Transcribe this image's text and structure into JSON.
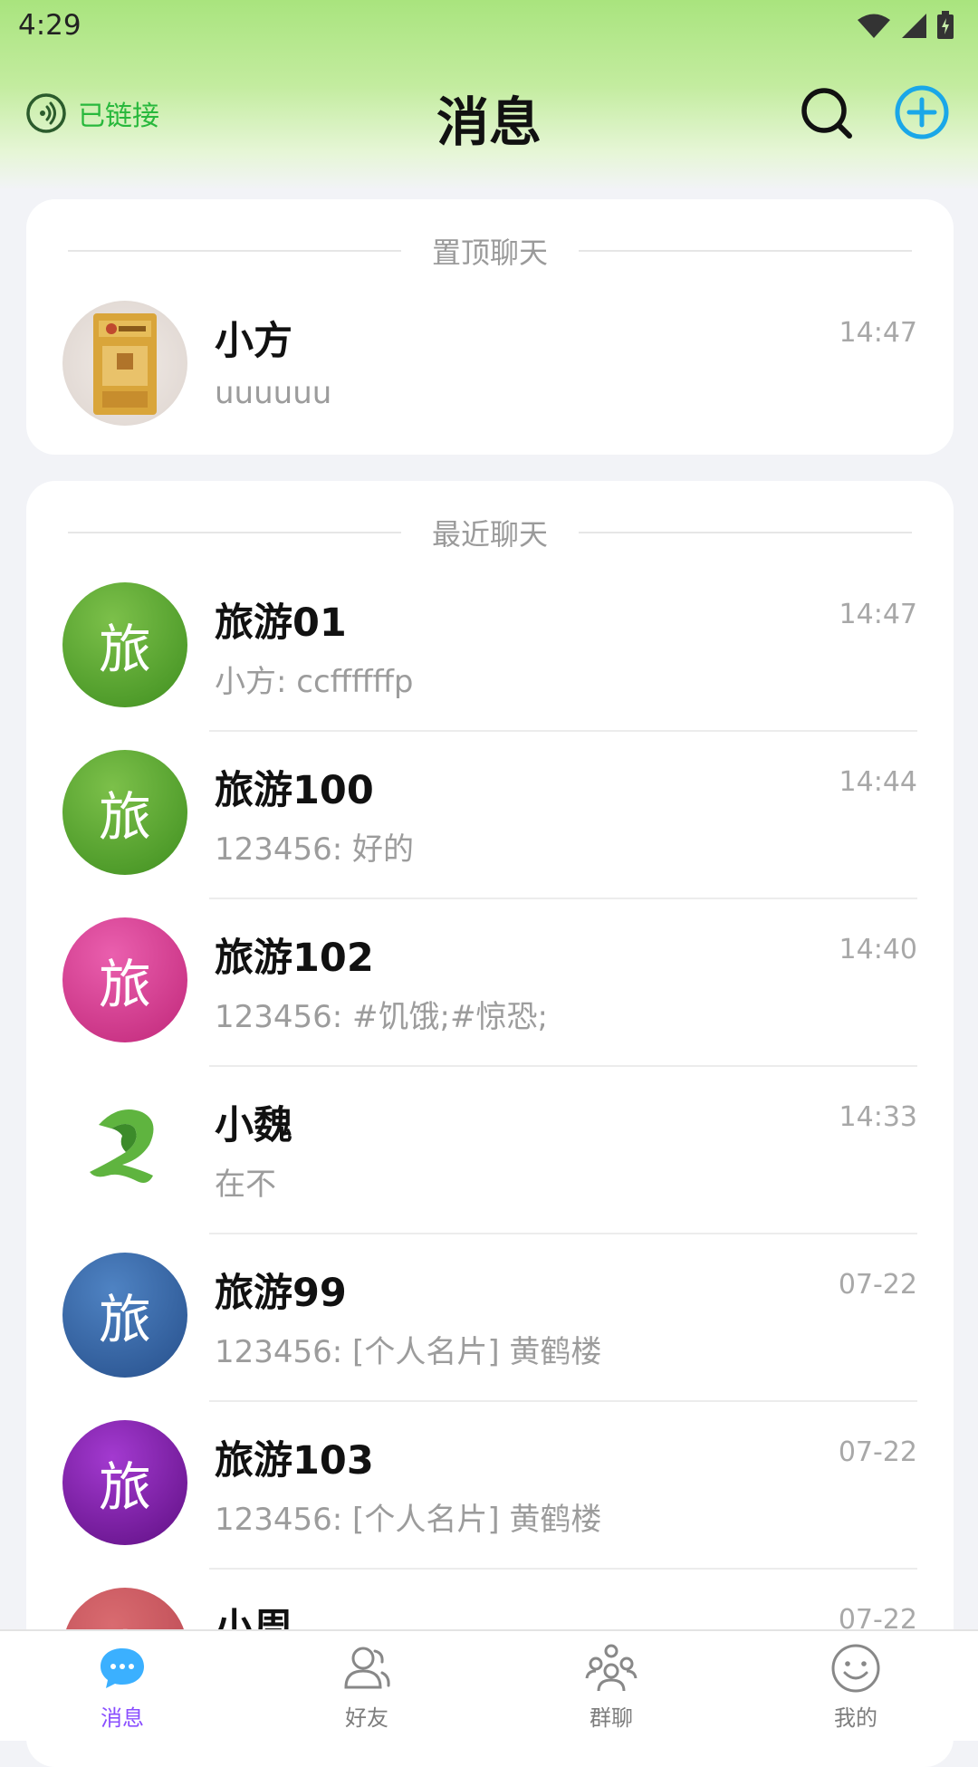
{
  "status_bar": {
    "time": "4:29",
    "icons": [
      "wifi-icon",
      "signal-icon",
      "battery-icon"
    ]
  },
  "header": {
    "connection_status": "已链接",
    "title": "消息",
    "search_icon": "search-icon",
    "add_icon": "add-circle-icon"
  },
  "pinned": {
    "section_title": "置顶聊天",
    "items": [
      {
        "name": "小方",
        "time": "14:47",
        "preview": "uuuuuu",
        "avatar_text": "",
        "avatar_style": "photo"
      }
    ]
  },
  "recent": {
    "section_title": "最近聊天",
    "items": [
      {
        "name": "旅游01",
        "time": "14:47",
        "preview": "小方: ccffffffp",
        "avatar_text": "旅",
        "avatar_style": "green"
      },
      {
        "name": "旅游100",
        "time": "14:44",
        "preview": "123456: 好的",
        "avatar_text": "旅",
        "avatar_style": "green"
      },
      {
        "name": "旅游102",
        "time": "14:40",
        "preview": "123456: #饥饿;#惊恐;",
        "avatar_text": "旅",
        "avatar_style": "pink"
      },
      {
        "name": "小魏",
        "time": "14:33",
        "preview": "在不",
        "avatar_text": "",
        "avatar_style": "logo"
      },
      {
        "name": "旅游99",
        "time": "07-22",
        "preview": "123456: [个人名片] 黄鹤楼",
        "avatar_text": "旅",
        "avatar_style": "blue"
      },
      {
        "name": "旅游103",
        "time": "07-22",
        "preview": "123456: [个人名片] 黄鹤楼",
        "avatar_text": "旅",
        "avatar_style": "purple"
      },
      {
        "name": "小周",
        "time": "07-22",
        "preview": "",
        "avatar_text": "小",
        "avatar_style": "red"
      }
    ]
  },
  "bottom_nav": {
    "items": [
      {
        "label": "消息",
        "icon": "message-icon",
        "active": true
      },
      {
        "label": "好友",
        "icon": "friends-icon",
        "active": false
      },
      {
        "label": "群聊",
        "icon": "group-chat-icon",
        "active": false
      },
      {
        "label": "我的",
        "icon": "profile-icon",
        "active": false
      }
    ]
  },
  "colors": {
    "connected": "#28b83c",
    "accent": "#8a4fff",
    "add_button": "#1aa7e8"
  }
}
